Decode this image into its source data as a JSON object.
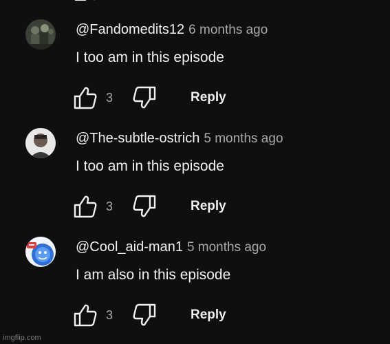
{
  "comments": [
    {
      "author": "@Fandomedits12",
      "time": "6 months ago",
      "text": "I too am in this episode",
      "likes": "3",
      "reply_label": "Reply",
      "avatar_icon": "dark-figures-avatar"
    },
    {
      "author": "@The-subtle-ostrich",
      "time": "5 months ago",
      "text": "I too am in this episode",
      "likes": "3",
      "reply_label": "Reply",
      "avatar_icon": "person-photo-avatar"
    },
    {
      "author": "@Cool_aid-man1",
      "time": "5 months ago",
      "text": "I am also in this episode",
      "likes": "3",
      "reply_label": "Reply",
      "avatar_icon": "kool-aid-avatar"
    }
  ],
  "watermark": "imgflip.com",
  "colors": {
    "background": "#0f0f0f",
    "primary_text": "#f1f1f1",
    "secondary_text": "#aaaaaa"
  }
}
